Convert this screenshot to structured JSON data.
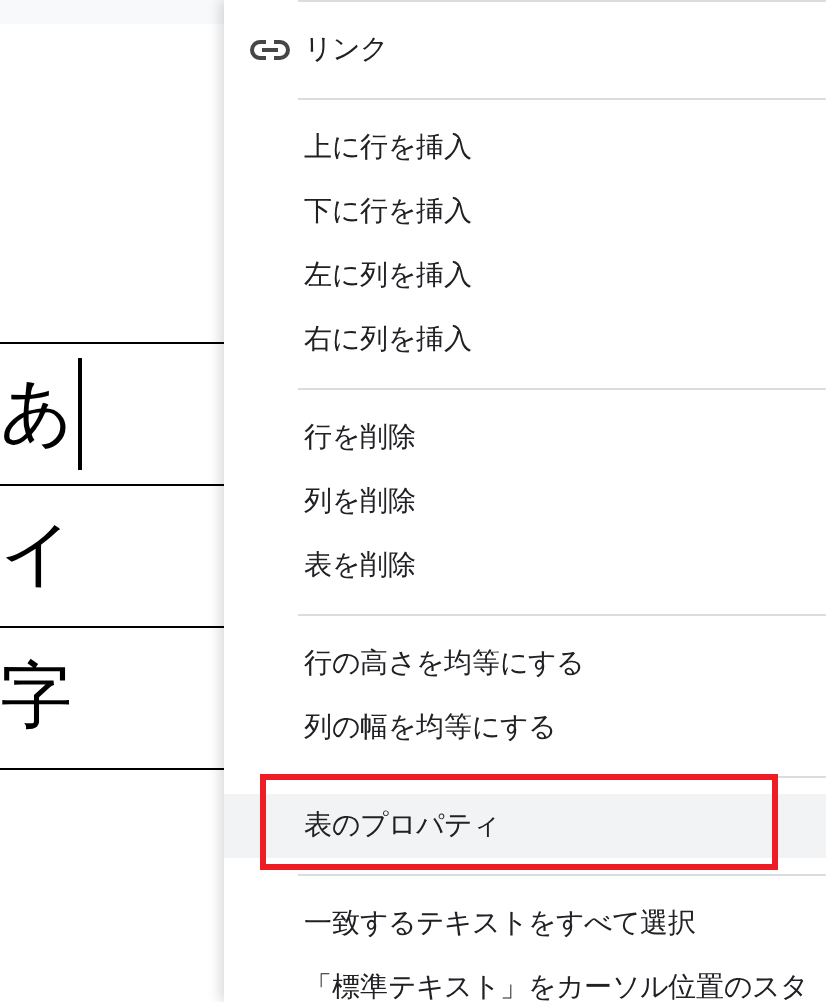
{
  "document": {
    "table": {
      "rows": [
        {
          "text": "あ",
          "cursor": true
        },
        {
          "text": "イ",
          "cursor": false
        },
        {
          "text": "字",
          "cursor": false
        }
      ]
    }
  },
  "context_menu": {
    "sections": [
      [
        {
          "label": "リンク",
          "kind": "link",
          "selected": false
        }
      ],
      [
        {
          "label": "上に行を挿入",
          "kind": "plain",
          "selected": false
        },
        {
          "label": "下に行を挿入",
          "kind": "plain",
          "selected": false
        },
        {
          "label": "左に列を挿入",
          "kind": "plain",
          "selected": false
        },
        {
          "label": "右に列を挿入",
          "kind": "plain",
          "selected": false
        }
      ],
      [
        {
          "label": "行を削除",
          "kind": "plain",
          "selected": false
        },
        {
          "label": "列を削除",
          "kind": "plain",
          "selected": false
        },
        {
          "label": "表を削除",
          "kind": "plain",
          "selected": false
        }
      ],
      [
        {
          "label": "行の高さを均等にする",
          "kind": "plain",
          "selected": false
        },
        {
          "label": "列の幅を均等にする",
          "kind": "plain",
          "selected": false
        }
      ],
      [
        {
          "label": "表のプロパティ",
          "kind": "plain",
          "selected": true
        }
      ],
      [
        {
          "label": "一致するテキストをすべて選択",
          "kind": "plain",
          "selected": false
        },
        {
          "label": "「標準テキスト」をカーソル位置のスタ",
          "kind": "plain",
          "selected": false
        }
      ]
    ]
  }
}
